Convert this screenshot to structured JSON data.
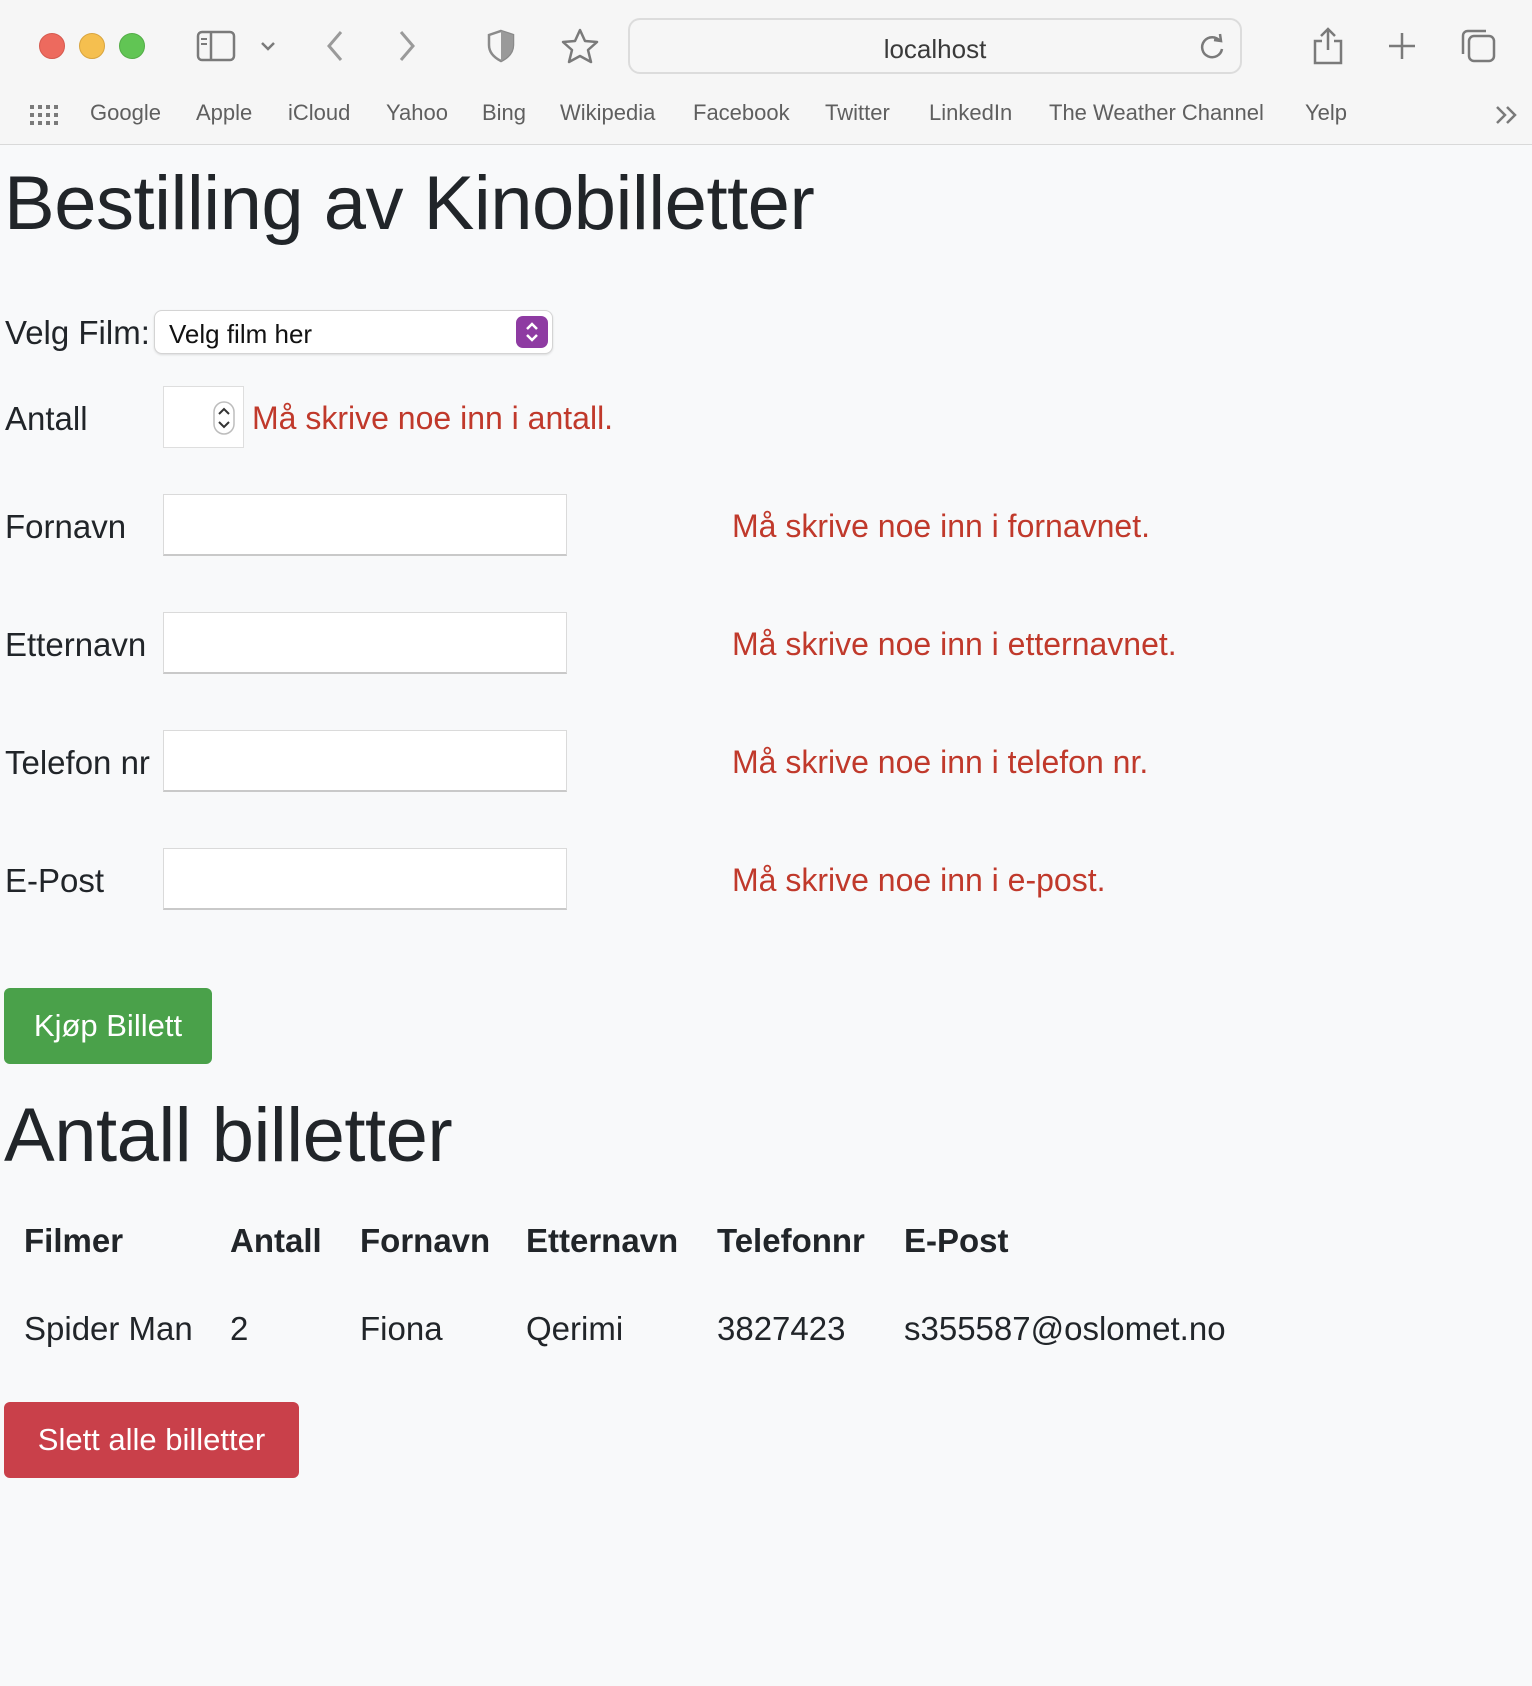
{
  "browser": {
    "url": "localhost",
    "bookmarks": [
      "Google",
      "Apple",
      "iCloud",
      "Yahoo",
      "Bing",
      "Wikipedia",
      "Facebook",
      "Twitter",
      "LinkedIn",
      "The Weather Channel",
      "Yelp"
    ]
  },
  "page": {
    "title": "Bestilling av Kinobilletter",
    "form": {
      "film_label": "Velg Film:",
      "film_selected": "Velg film her",
      "antall_label": "Antall",
      "antall_value": "",
      "antall_error": "Må skrive noe inn i antall.",
      "fornavn_label": "Fornavn",
      "fornavn_value": "",
      "fornavn_error": "Må skrive noe inn i fornavnet.",
      "etternavn_label": "Etternavn",
      "etternavn_value": "",
      "etternavn_error": "Må skrive noe inn i etternavnet.",
      "telefon_label": "Telefon nr",
      "telefon_value": "",
      "telefon_error": "Må skrive noe inn i telefon nr.",
      "epost_label": "E-Post",
      "epost_value": "",
      "epost_error": "Må skrive noe inn i e-post.",
      "buy_button": "Kjøp Billett"
    },
    "tickets_title": "Antall billetter",
    "table": {
      "headers": [
        "Filmer",
        "Antall",
        "Fornavn",
        "Etternavn",
        "Telefonnr",
        "E-Post"
      ],
      "rows": [
        [
          "Spider Man",
          "2",
          "Fiona",
          "Qerimi",
          "3827423",
          "s355587@oslomet.no"
        ]
      ]
    },
    "delete_button": "Slett alle billetter"
  },
  "colors": {
    "error_text": "#c0392b",
    "buy_button": "#4aa14a",
    "delete_button": "#c9404a",
    "select_accent": "#8e3ba2"
  }
}
